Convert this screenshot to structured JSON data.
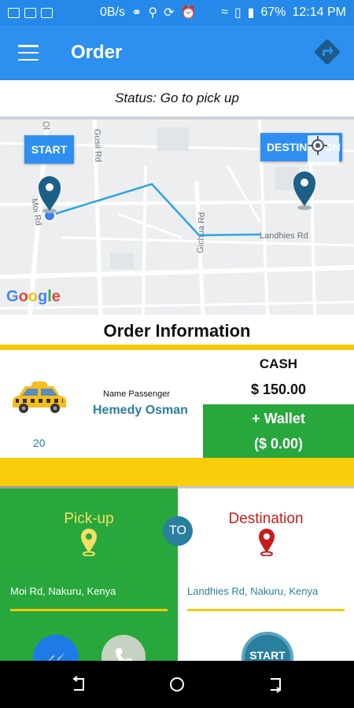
{
  "status_bar": {
    "network_speed": "0B/s",
    "battery": "67%",
    "time": "12:14 PM"
  },
  "app_bar": {
    "title": "Order",
    "icons": [
      "menu-icon",
      "navigation-icon"
    ]
  },
  "order_status": "Status: Go to pick up",
  "map": {
    "start_label": "START",
    "destination_label": "DESTINATION",
    "street_labels": [
      "Moi Rd",
      "Gusii Rd",
      "Gichua Rd",
      "Landhies Rd",
      "Ol"
    ],
    "google_logo": "Google"
  },
  "order_info": {
    "title": "Order Information",
    "seat_number": "20",
    "passenger_label": "Name Passenger",
    "passenger_name": "Hemedy Osman",
    "payment_method": "CASH",
    "price": "$ 150.00",
    "wallet_label": "+ Wallet",
    "wallet_amount": "($ 0.00)"
  },
  "trip": {
    "pickup_title": "Pick-up",
    "pickup_address": "Moi Rd, Nakuru, Kenya",
    "connector": "TO",
    "destination_title": "Destination",
    "destination_address": "Landhies Rd, Nakuru, Kenya",
    "start_button": "START"
  },
  "colors": {
    "primary_blue": "#2d8fee",
    "green": "#28a73c",
    "yellow": "#f5cb08",
    "teal": "#2a7f9e",
    "red": "#c81c1c"
  }
}
